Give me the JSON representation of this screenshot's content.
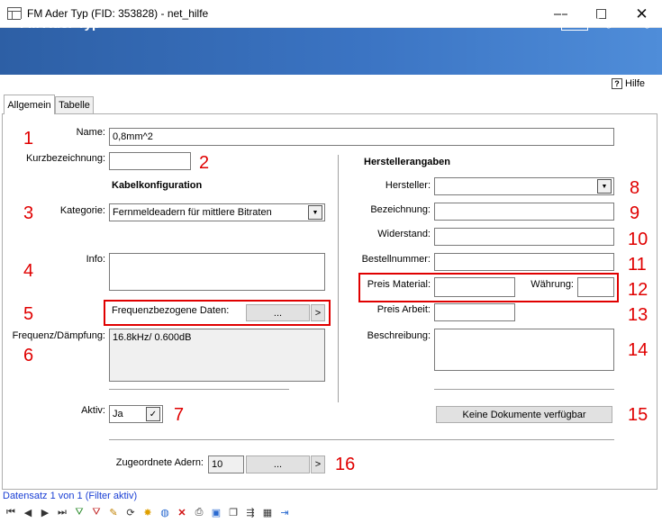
{
  "window": {
    "title": "FM Ader Typ (FID: 353828) - net_hilfe",
    "minimize_glyph": "—",
    "maximize_glyph": "☐",
    "close_glyph": "✕"
  },
  "header": {
    "title": "FM Ader Typ",
    "brand_box": "NET",
    "brand_text": "Engineering"
  },
  "help": {
    "icon": "?",
    "label": "Hilfe"
  },
  "tabs": [
    {
      "label": "Allgemein",
      "active": true
    },
    {
      "label": "Tabelle",
      "active": false
    }
  ],
  "form": {
    "name_label": "Name:",
    "name_value": "0,8mm^2",
    "kurz_label": "Kurzbezeichnung:",
    "kurz_value": "",
    "kabel_title": "Kabelkonfiguration",
    "kategorie_label": "Kategorie:",
    "kategorie_value": "Fernmeldeadern für mittlere Bitraten",
    "info_label": "Info:",
    "info_value": "",
    "freq_label": "Frequenzbezogene Daten:",
    "ellipsis": "...",
    "arrow": ">",
    "freq_daempf_label": "Frequenz/Dämpfung:",
    "freq_daempf_value": "16.8kHz/ 0.600dB",
    "aktiv_label": "Aktiv:",
    "aktiv_value": "Ja",
    "hersteller_title": "Herstellerangaben",
    "hersteller_label": "Hersteller:",
    "bezeichnung_label": "Bezeichnung:",
    "widerstand_label": "Widerstand:",
    "bestell_label": "Bestellnummer:",
    "preis_material_label": "Preis Material:",
    "waehrung_label": "Währung:",
    "preis_arbeit_label": "Preis Arbeit:",
    "beschreibung_label": "Beschreibung:",
    "dokumente_label": "Keine Dokumente verfügbar",
    "adern_label": "Zugeordnete Adern:",
    "adern_value": "10"
  },
  "annotations": [
    "1",
    "2",
    "3",
    "4",
    "5",
    "6",
    "7",
    "8",
    "9",
    "10",
    "11",
    "12",
    "13",
    "14",
    "15",
    "16"
  ],
  "status": {
    "record_text": "Datensatz 1 von 1 (Filter aktiv)"
  },
  "colors": {
    "header_blue": "#3b74c3",
    "annotation_red": "#e00000",
    "status_blue": "#1a3fd4"
  }
}
